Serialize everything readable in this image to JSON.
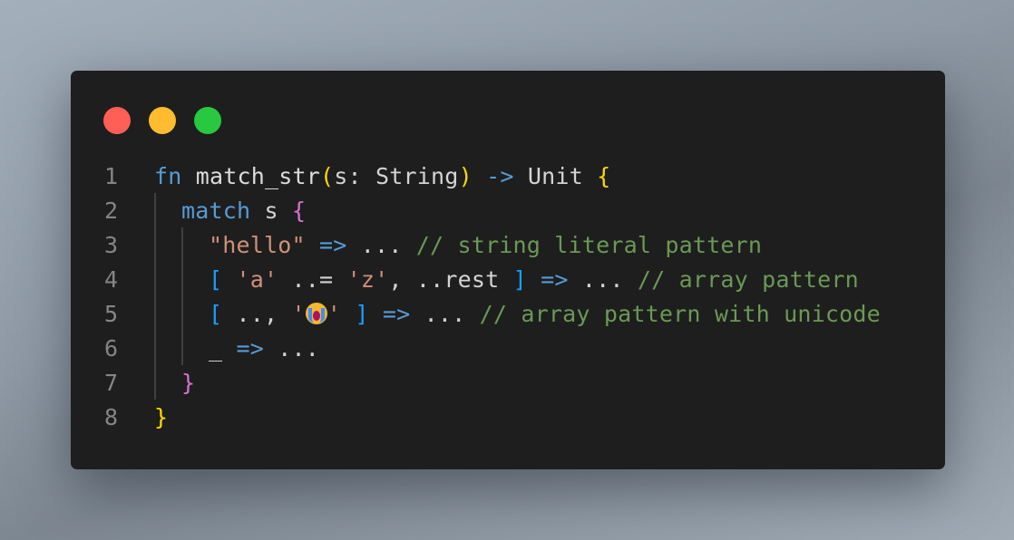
{
  "window": {
    "controls": [
      {
        "name": "close",
        "color": "#ff5f57"
      },
      {
        "name": "minimize",
        "color": "#febc2e"
      },
      {
        "name": "maximize",
        "color": "#28c840"
      }
    ]
  },
  "code": {
    "language": "moonbit",
    "lines": [
      {
        "number": "1",
        "tokens": [
          {
            "t": "fn",
            "c": "kw"
          },
          {
            "t": " match_str",
            "c": "fnname"
          },
          {
            "t": "(",
            "c": "br1"
          },
          {
            "t": "s: String",
            "c": "ty"
          },
          {
            "t": ")",
            "c": "br1"
          },
          {
            "t": " -> ",
            "c": "op"
          },
          {
            "t": "Unit ",
            "c": "ty"
          },
          {
            "t": "{",
            "c": "br1"
          }
        ]
      },
      {
        "number": "2",
        "indent": 1,
        "tokens": [
          {
            "t": "match",
            "c": "kw"
          },
          {
            "t": " s ",
            "c": "ty"
          },
          {
            "t": "{",
            "c": "br2"
          }
        ]
      },
      {
        "number": "3",
        "indent": 2,
        "tokens": [
          {
            "t": "\"hello\"",
            "c": "str"
          },
          {
            "t": " => ",
            "c": "op"
          },
          {
            "t": "... ",
            "c": "ty"
          },
          {
            "t": "// string literal pattern",
            "c": "cm"
          }
        ]
      },
      {
        "number": "4",
        "indent": 2,
        "tokens": [
          {
            "t": "[",
            "c": "br3"
          },
          {
            "t": " ",
            "c": "ty"
          },
          {
            "t": "'a'",
            "c": "str"
          },
          {
            "t": " ..= ",
            "c": "ty"
          },
          {
            "t": "'z'",
            "c": "str"
          },
          {
            "t": ", ..rest ",
            "c": "ty"
          },
          {
            "t": "]",
            "c": "br3"
          },
          {
            "t": " => ",
            "c": "op"
          },
          {
            "t": "... ",
            "c": "ty"
          },
          {
            "t": "// array pattern",
            "c": "cm"
          }
        ]
      },
      {
        "number": "5",
        "indent": 2,
        "tokens": [
          {
            "t": "[",
            "c": "br3"
          },
          {
            "t": " .., ",
            "c": "ty"
          },
          {
            "t": "'",
            "c": "str"
          },
          {
            "emoji": "loudly-crying-face"
          },
          {
            "t": "'",
            "c": "str"
          },
          {
            "t": " ",
            "c": "ty"
          },
          {
            "t": "]",
            "c": "br3"
          },
          {
            "t": " => ",
            "c": "op"
          },
          {
            "t": "... ",
            "c": "ty"
          },
          {
            "t": "// array pattern with unicode",
            "c": "cm"
          }
        ]
      },
      {
        "number": "6",
        "indent": 2,
        "tokens": [
          {
            "t": "_",
            "c": "ty"
          },
          {
            "t": " => ",
            "c": "op"
          },
          {
            "t": "...",
            "c": "ty"
          }
        ]
      },
      {
        "number": "7",
        "indent": 1,
        "tokens": [
          {
            "t": "}",
            "c": "br2"
          }
        ]
      },
      {
        "number": "8",
        "tokens": [
          {
            "t": "}",
            "c": "br1"
          }
        ]
      }
    ]
  }
}
